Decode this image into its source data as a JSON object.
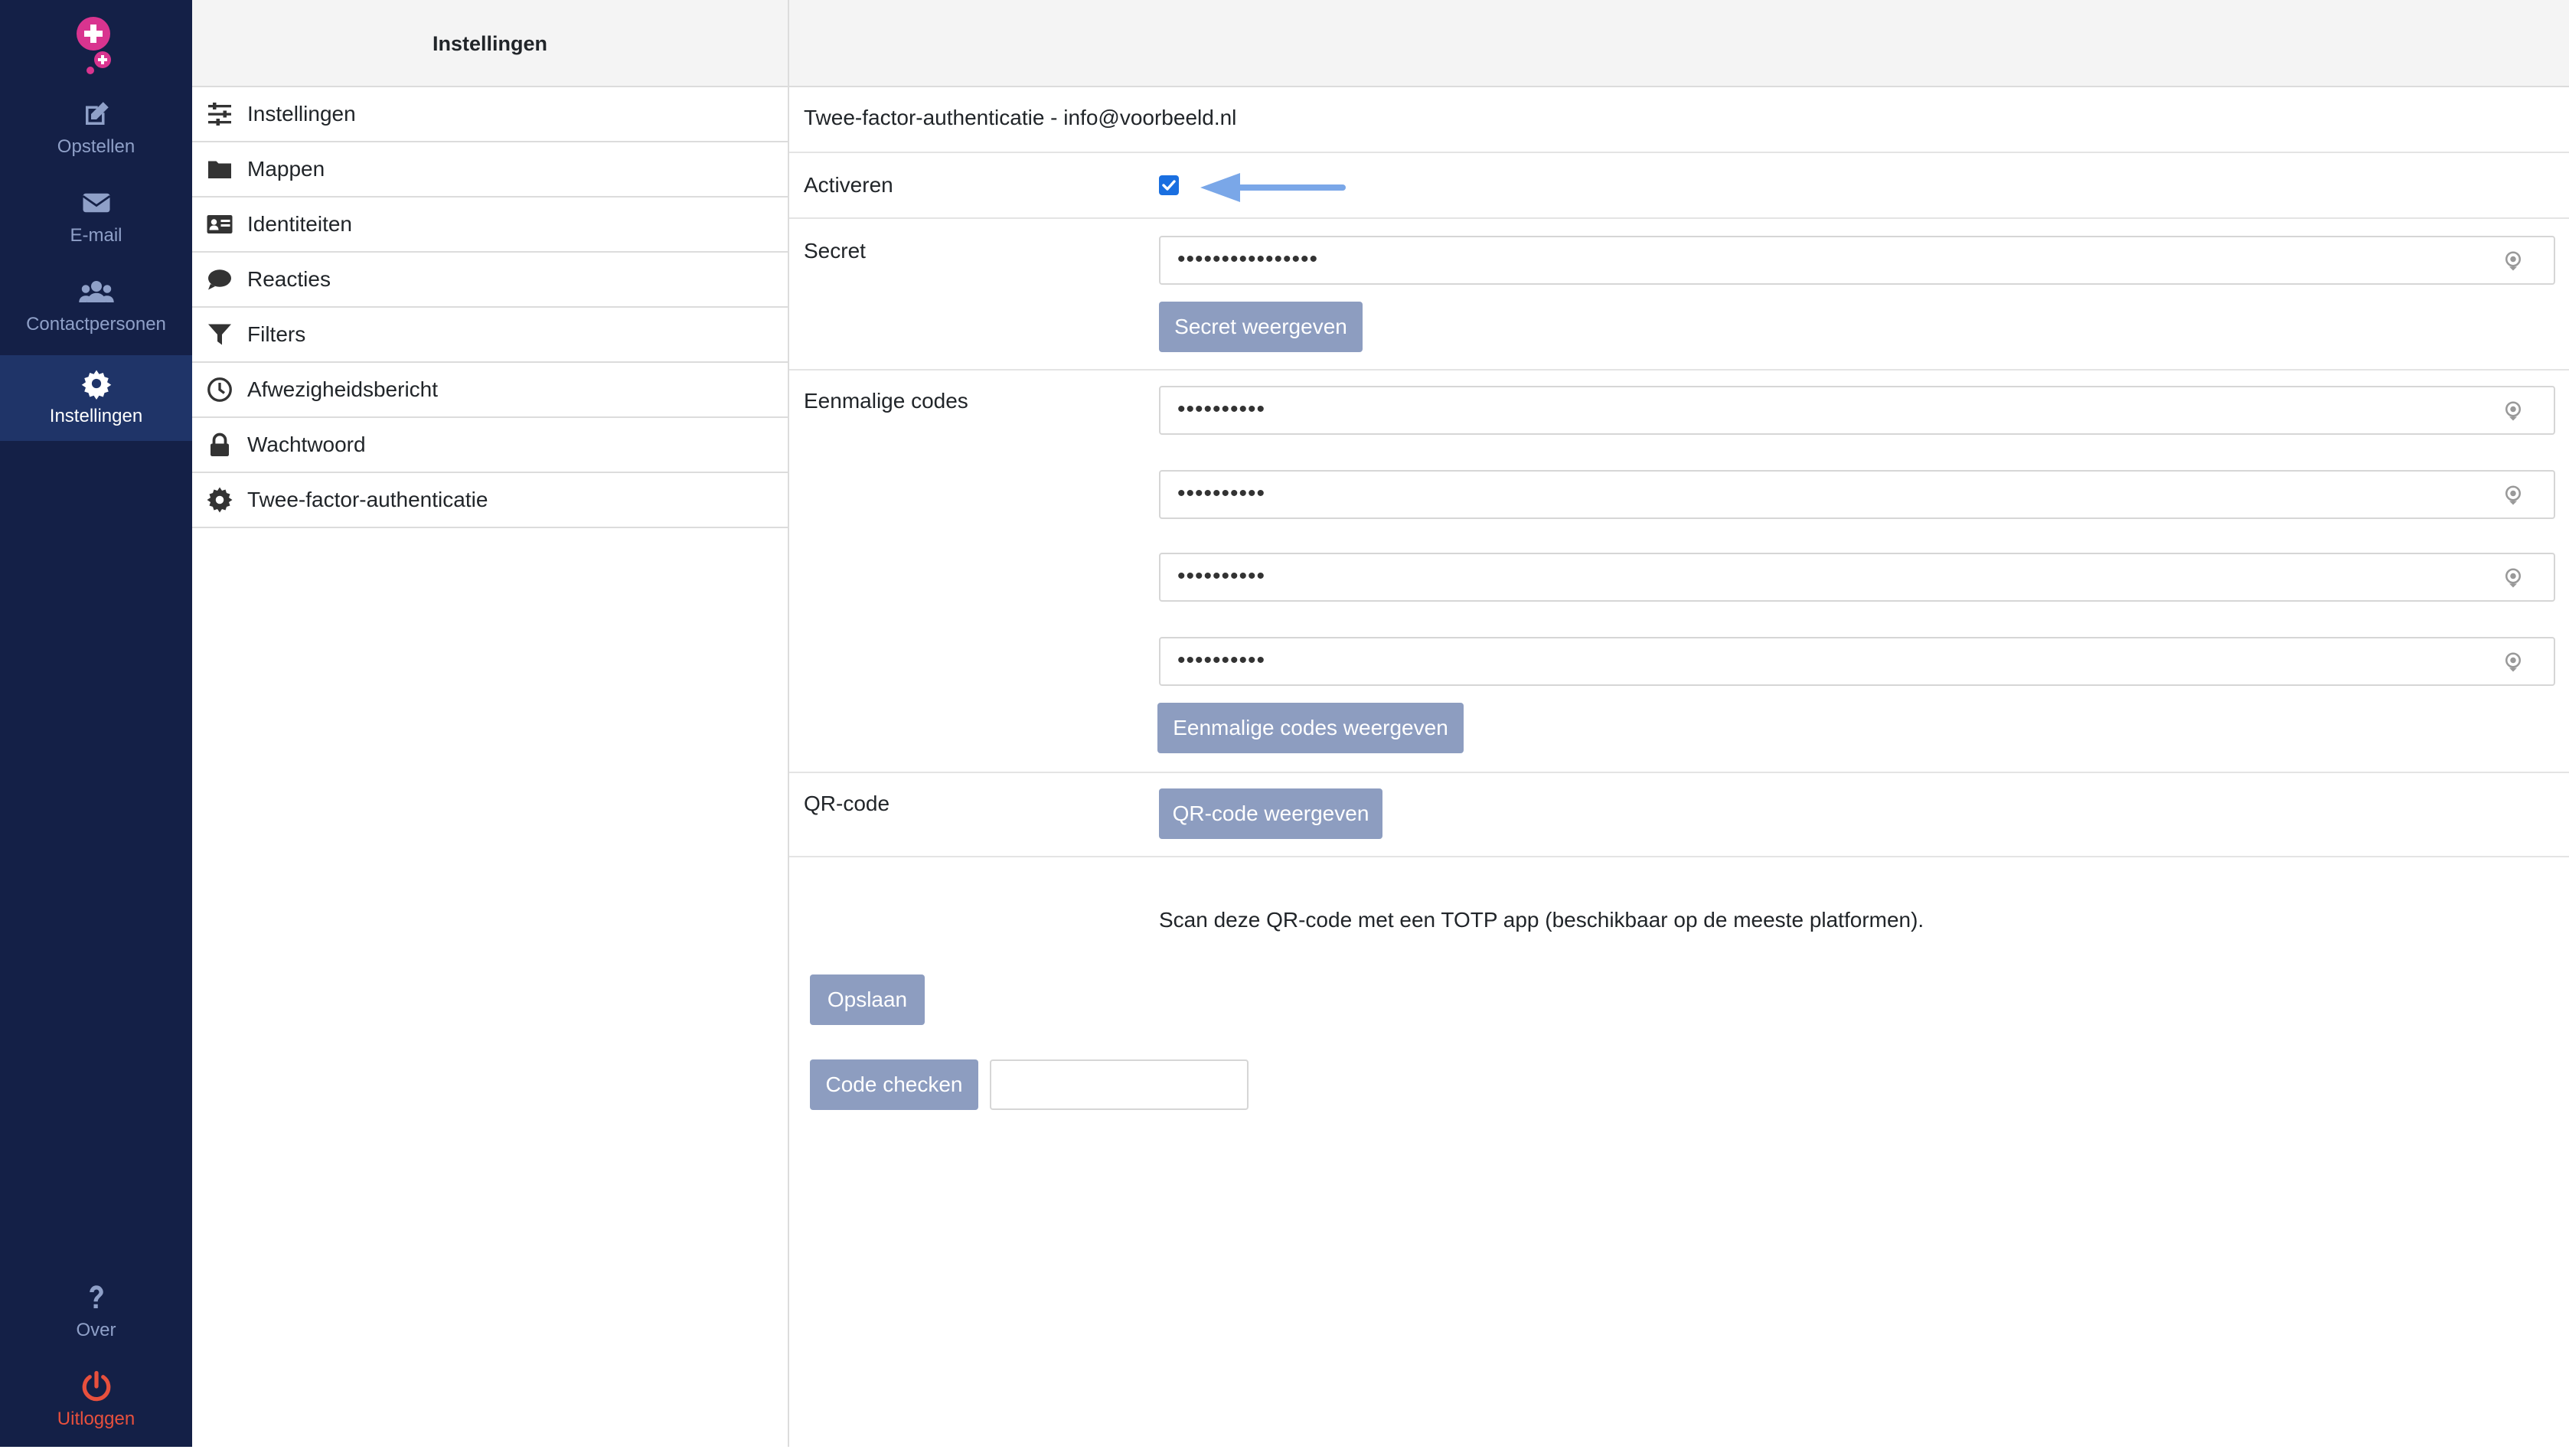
{
  "nav": {
    "compose": "Opstellen",
    "email": "E-mail",
    "contacts": "Contactpersonen",
    "settings": "Instellingen",
    "about": "Over",
    "logout": "Uitloggen"
  },
  "settings_panel": {
    "title": "Instellingen",
    "items": [
      {
        "label": "Instellingen",
        "icon": "sliders-icon"
      },
      {
        "label": "Mappen",
        "icon": "folder-icon"
      },
      {
        "label": "Identiteiten",
        "icon": "id-card-icon"
      },
      {
        "label": "Reacties",
        "icon": "speech-bubble-icon"
      },
      {
        "label": "Filters",
        "icon": "filter-icon"
      },
      {
        "label": "Afwezigheidsbericht",
        "icon": "clock-icon"
      },
      {
        "label": "Wachtwoord",
        "icon": "lock-icon"
      },
      {
        "label": "Twee-factor-authenticatie",
        "icon": "gear-icon"
      }
    ]
  },
  "main": {
    "heading": "Twee-factor-authenticatie - info@voorbeeld.nl",
    "activate": {
      "label": "Activeren",
      "checked": true
    },
    "secret": {
      "label": "Secret",
      "value": "••••••••••••••••",
      "button": "Secret weergeven"
    },
    "codes": {
      "label": "Eenmalige codes",
      "values": [
        "••••••••••",
        "••••••••••",
        "••••••••••",
        "••••••••••"
      ],
      "button": "Eenmalige codes weergeven"
    },
    "qr": {
      "label": "QR-code",
      "button": "QR-code weergeven",
      "hint": "Scan deze QR-code met een TOTP app (beschikbaar op de meeste platformen)."
    },
    "save_button": "Opslaan",
    "check_button": "Code checken",
    "check_input": ""
  },
  "colors": {
    "nav_bg": "#142047",
    "nav_active": "#1f3468",
    "button_bg": "#8d9dc0",
    "logout": "#e8503d",
    "checkbox": "#1a6fe0",
    "arrow": "#7aa7e8",
    "logo": "#d9348f"
  }
}
